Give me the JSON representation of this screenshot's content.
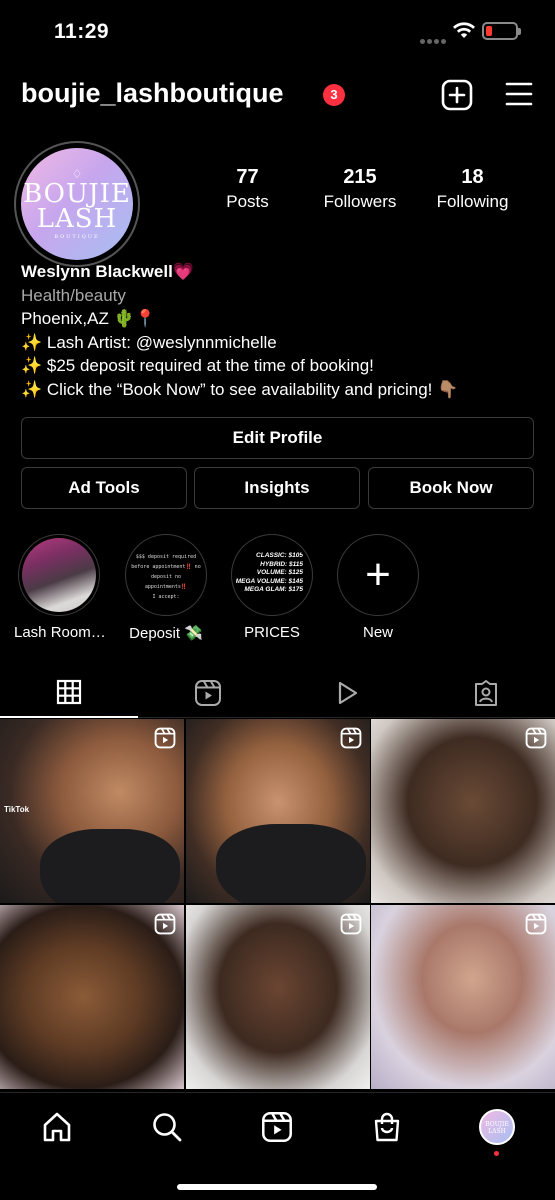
{
  "status_bar": {
    "time": "11:29"
  },
  "header": {
    "username": "boujie_lashboutique",
    "notification_count": "3"
  },
  "profile": {
    "avatar_text": [
      "BOUJIE",
      "LASH",
      "BOUTIQUE"
    ],
    "stats": [
      {
        "value": "77",
        "label": "Posts"
      },
      {
        "value": "215",
        "label": "Followers"
      },
      {
        "value": "18",
        "label": "Following"
      }
    ],
    "name": "Weslynn Blackwell💗",
    "category": "Health/beauty",
    "bio_lines": [
      "Phoenix,AZ 🌵📍",
      "✨ Lash Artist: @weslynnmichelle",
      "✨ $25 deposit required at the time of booking!",
      "✨ Click the “Book Now” to see availability and pricing! 👇🏽"
    ]
  },
  "buttons": {
    "edit_profile": "Edit Profile",
    "ad_tools": "Ad Tools",
    "insights": "Insights",
    "book_now": "Book Now"
  },
  "highlights": [
    {
      "label": "Lash Room…"
    },
    {
      "label": "Deposit 💸",
      "cover_lines": [
        "$$$ deposit required",
        "before appointment‼️ no",
        "deposit no",
        "appointments‼️",
        "I accept:"
      ]
    },
    {
      "label": "PRICES",
      "cover_lines": [
        "CLASSIC: $105",
        "HYBRID: $115",
        "VOLUME: $125",
        "MEGA VOLUME: $145",
        "MEGA GLAM: $175"
      ]
    },
    {
      "label": "New"
    }
  ],
  "grid": {
    "watermark": "TikTok"
  },
  "colors": {
    "background": "#000000",
    "notification": "#ff3040",
    "border": "#3a3a3a",
    "secondary_text": "#a8a8a8"
  }
}
